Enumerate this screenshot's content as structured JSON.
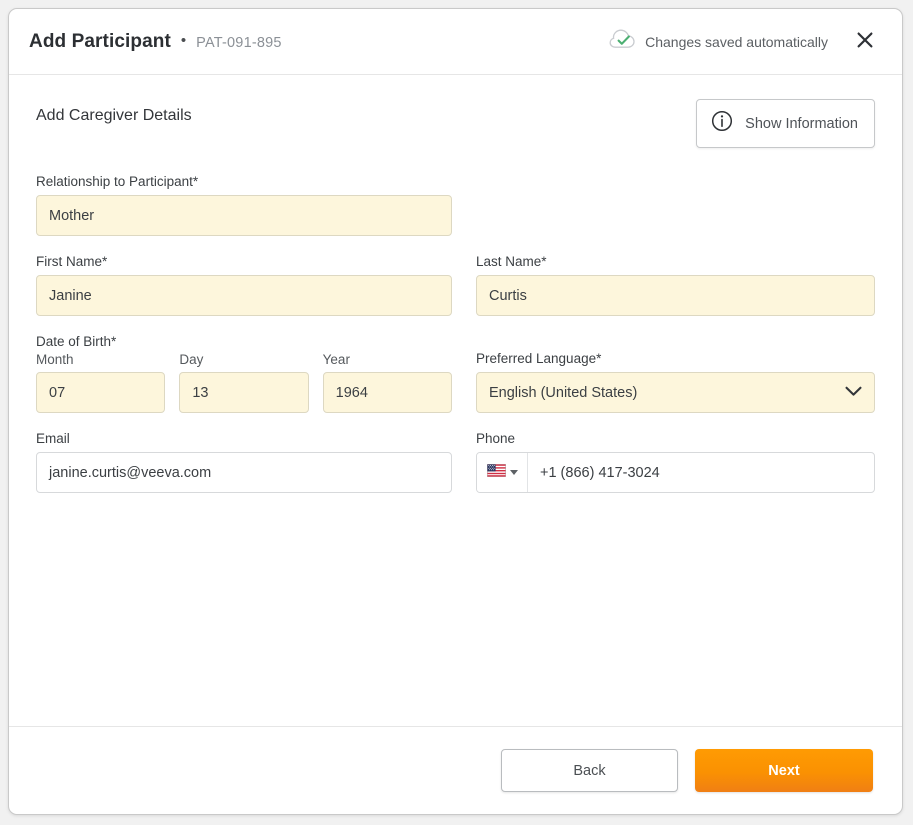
{
  "header": {
    "title": "Add Participant",
    "separator": "•",
    "subtitle": "PAT-091-895",
    "save_status": "Changes saved automatically",
    "save_icon": "cloud-check-icon",
    "close_icon": "close-icon"
  },
  "body": {
    "section_title": "Add Caregiver Details",
    "info_button": {
      "label": "Show Information",
      "icon": "info-circle-icon"
    },
    "fields": {
      "relationship": {
        "label": "Relationship to Participant*",
        "value": "Mother"
      },
      "first_name": {
        "label": "First Name*",
        "value": "Janine"
      },
      "last_name": {
        "label": "Last Name*",
        "value": "Curtis"
      },
      "date_of_birth": {
        "label": "Date of Birth*",
        "month": {
          "label": "Month",
          "value": "07"
        },
        "day": {
          "label": "Day",
          "value": "13"
        },
        "year": {
          "label": "Year",
          "value": "1964"
        }
      },
      "preferred_language": {
        "label": "Preferred Language*",
        "value": "English (United States)",
        "chevron_icon": "chevron-down-icon"
      },
      "email": {
        "label": "Email",
        "value": "janine.curtis@veeva.com"
      },
      "phone": {
        "label": "Phone",
        "country_flag": "us-flag-icon",
        "value": "+1 (866) 417-3024"
      }
    }
  },
  "footer": {
    "back_label": "Back",
    "next_label": "Next"
  },
  "colors": {
    "required_field_bg": "#FDF6DC",
    "primary_button": "#FA9102",
    "save_check": "#4CAF72",
    "page_bg": "#F1F1F1"
  }
}
